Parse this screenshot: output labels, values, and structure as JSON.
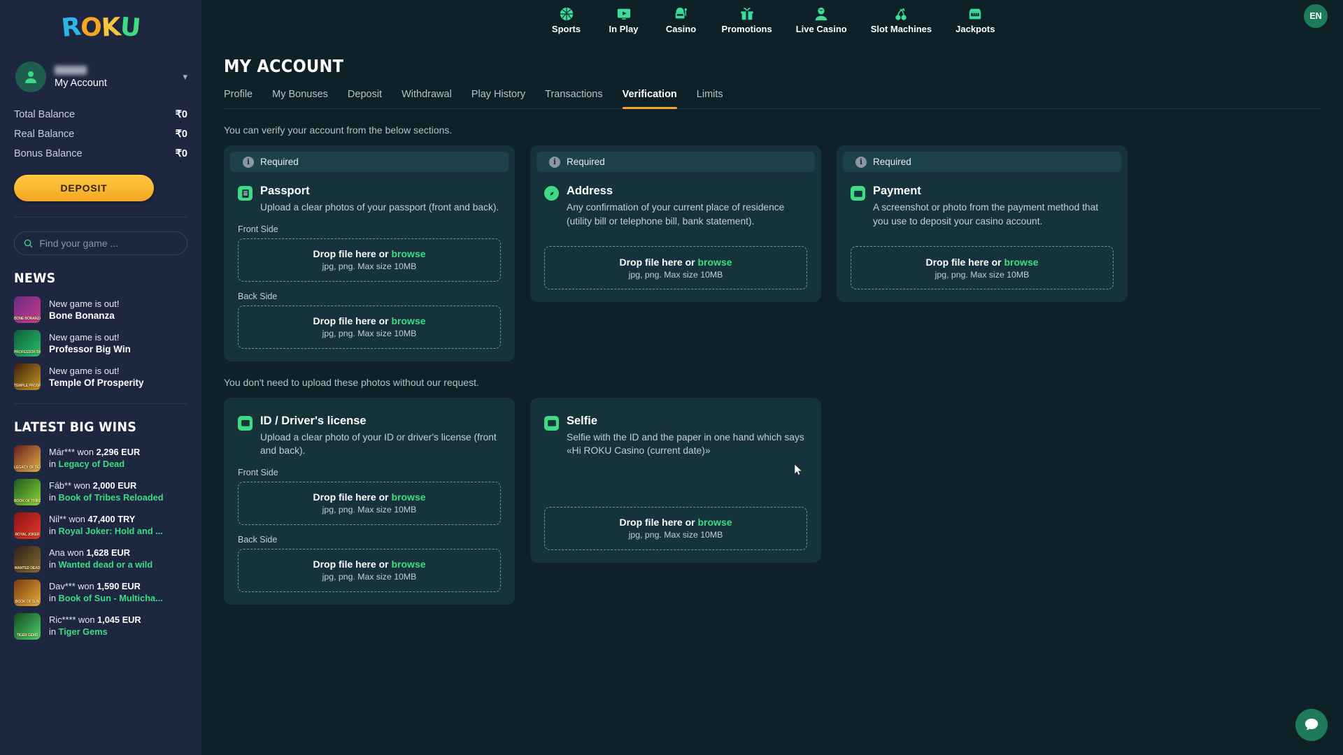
{
  "brand": {
    "logo_text": "ROKU",
    "logo_letters": [
      "R",
      "O",
      "K",
      "U"
    ]
  },
  "sidebar": {
    "account": {
      "label": "My Account",
      "name_masked": "",
      "chevron": "chevron-down-icon"
    },
    "balances": [
      {
        "label": "Total Balance",
        "value": "₹0"
      },
      {
        "label": "Real Balance",
        "value": "₹0"
      },
      {
        "label": "Bonus Balance",
        "value": "₹0"
      }
    ],
    "deposit_button": "DEPOSIT",
    "search": {
      "placeholder": "Find your game ...",
      "value": "",
      "icon": "search-icon"
    },
    "news_title": "NEWS",
    "news": [
      {
        "line1": "New game is out!",
        "line2": "Bone Bonanza",
        "thumb_label": "BONE BONANZA",
        "c1": "#6d2a86",
        "c2": "#c33d8a"
      },
      {
        "line1": "New game is out!",
        "line2": "Professor Big Win",
        "thumb_label": "PROFESSOR BIGWIN",
        "c1": "#0c5e3a",
        "c2": "#2bbf6e"
      },
      {
        "line1": "New game is out!",
        "line2": "Temple Of Prosperity",
        "thumb_label": "TEMPLE PROSPERITY",
        "c1": "#3b2008",
        "c2": "#c9962a"
      }
    ],
    "wins_title": "LATEST BIG WINS",
    "wins": [
      {
        "player": "Már***",
        "won": "won",
        "amount": "2,296 EUR",
        "in": "in",
        "game": "Legacy of Dead",
        "thumb_label": "LEGACY OF DEAD",
        "c1": "#6b1b1b",
        "c2": "#e0b14a"
      },
      {
        "player": "Fáb**",
        "won": "won",
        "amount": "2,000 EUR",
        "in": "in",
        "game": "Book of Tribes Reloaded",
        "thumb_label": "BOOK OF TRIBES",
        "c1": "#1d5b1d",
        "c2": "#8fd43a"
      },
      {
        "player": "Nil**",
        "won": "won",
        "amount": "47,400 TRY",
        "in": "in",
        "game": "Royal Joker: Hold and ...",
        "thumb_label": "ROYAL JOKER",
        "c1": "#8c1313",
        "c2": "#e03a2a"
      },
      {
        "player": "Ana",
        "won": "won",
        "amount": "1,628 EUR",
        "in": "in",
        "game": "Wanted dead or a wild",
        "thumb_label": "WANTED DEAD",
        "c1": "#2a2118",
        "c2": "#8a6a32"
      },
      {
        "player": "Dav***",
        "won": "won",
        "amount": "1,590 EUR",
        "in": "in",
        "game": "Book of Sun - Multicha...",
        "thumb_label": "BOOK OF SUN",
        "c1": "#7a3c0c",
        "c2": "#e8a93a"
      },
      {
        "player": "Ric****",
        "won": "won",
        "amount": "1,045 EUR",
        "in": "in",
        "game": "Tiger Gems",
        "thumb_label": "TIGER GEMS",
        "c1": "#12491f",
        "c2": "#4ed36a"
      }
    ]
  },
  "topnav": {
    "items": [
      {
        "label": "Sports",
        "icon": "basketball-icon"
      },
      {
        "label": "In Play",
        "icon": "play-screen-icon"
      },
      {
        "label": "Casino",
        "icon": "slot-machine-icon"
      },
      {
        "label": "Promotions",
        "icon": "gift-icon"
      },
      {
        "label": "Live Casino",
        "icon": "dealer-icon"
      },
      {
        "label": "Slot Machines",
        "icon": "cherry-icon"
      },
      {
        "label": "Jackpots",
        "icon": "jackpot-777-icon"
      }
    ],
    "language": "EN"
  },
  "page": {
    "title": "MY ACCOUNT",
    "tabs": [
      {
        "label": "Profile",
        "active": false
      },
      {
        "label": "My Bonuses",
        "active": false
      },
      {
        "label": "Deposit",
        "active": false
      },
      {
        "label": "Withdrawal",
        "active": false
      },
      {
        "label": "Play History",
        "active": false
      },
      {
        "label": "Transactions",
        "active": false
      },
      {
        "label": "Verification",
        "active": true
      },
      {
        "label": "Limits",
        "active": false
      }
    ],
    "hint_top": "You can verify your account from the below sections.",
    "hint_bottom": "You don't need to upload these photos without our request.",
    "required_label": "Required",
    "drop": {
      "main_pre": "Drop file here or ",
      "browse": "browse",
      "sub": "jpg, png. Max size 10MB"
    },
    "labels": {
      "front": "Front Side",
      "back": "Back Side"
    },
    "cards_row1": [
      {
        "status": "Required",
        "title": "Passport",
        "desc": "Upload a clear photos of your passport (front and back).",
        "icon": "passport-icon",
        "sides": [
          "Front Side",
          "Back Side"
        ]
      },
      {
        "status": "Required",
        "title": "Address",
        "desc": "Any confirmation of your current place of residence (utility bill or telephone bill, bank statement).",
        "icon": "compass-icon",
        "sides": []
      },
      {
        "status": "Required",
        "title": "Payment",
        "desc": "A screenshot or photo from the payment method that you use to deposit your casino account.",
        "icon": "wallet-icon",
        "sides": []
      }
    ],
    "cards_row2": [
      {
        "title": "ID / Driver's license",
        "desc": "Upload a clear photo of your ID or driver's license (front and back).",
        "icon": "id-card-icon",
        "sides": [
          "Front Side",
          "Back Side"
        ]
      },
      {
        "title": "Selfie",
        "desc": "Selfie with the ID and the paper in one hand which says «Hi ROKU Casino (current date)»",
        "icon": "id-card-icon",
        "sides": []
      }
    ],
    "chat": {
      "icon": "chat-bubble-icon"
    }
  },
  "colors": {
    "accent_green": "#3ddc84",
    "accent_orange": "#f5a623",
    "card_bg": "#16333b",
    "page_bg": "#0e2128",
    "sidebar_bg": "#1e2740"
  }
}
